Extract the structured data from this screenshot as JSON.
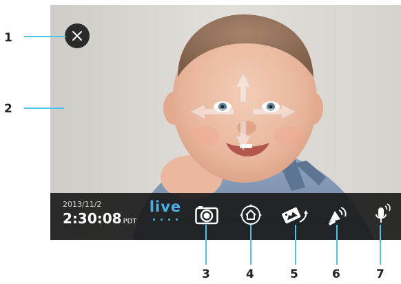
{
  "callouts": {
    "close": "1",
    "view": "2",
    "snapshot": "3",
    "home": "4",
    "pan": "5",
    "alarm": "6",
    "talk": "7"
  },
  "toolbar": {
    "date": "2013/11/2",
    "time": "2:30:08",
    "timezone": "PDT",
    "live_label": "live"
  },
  "icons": {
    "close": "close-icon",
    "pan_tilt": "pan-tilt-arrows-icon",
    "snapshot": "camera-icon",
    "home": "home-icon",
    "pan": "pan-view-icon",
    "alarm": "siren-icon",
    "talk": "microphone-icon"
  },
  "colors": {
    "accent": "#4ab3e6",
    "leader": "#4cc3e8",
    "toolbar_bg": "#181818"
  }
}
